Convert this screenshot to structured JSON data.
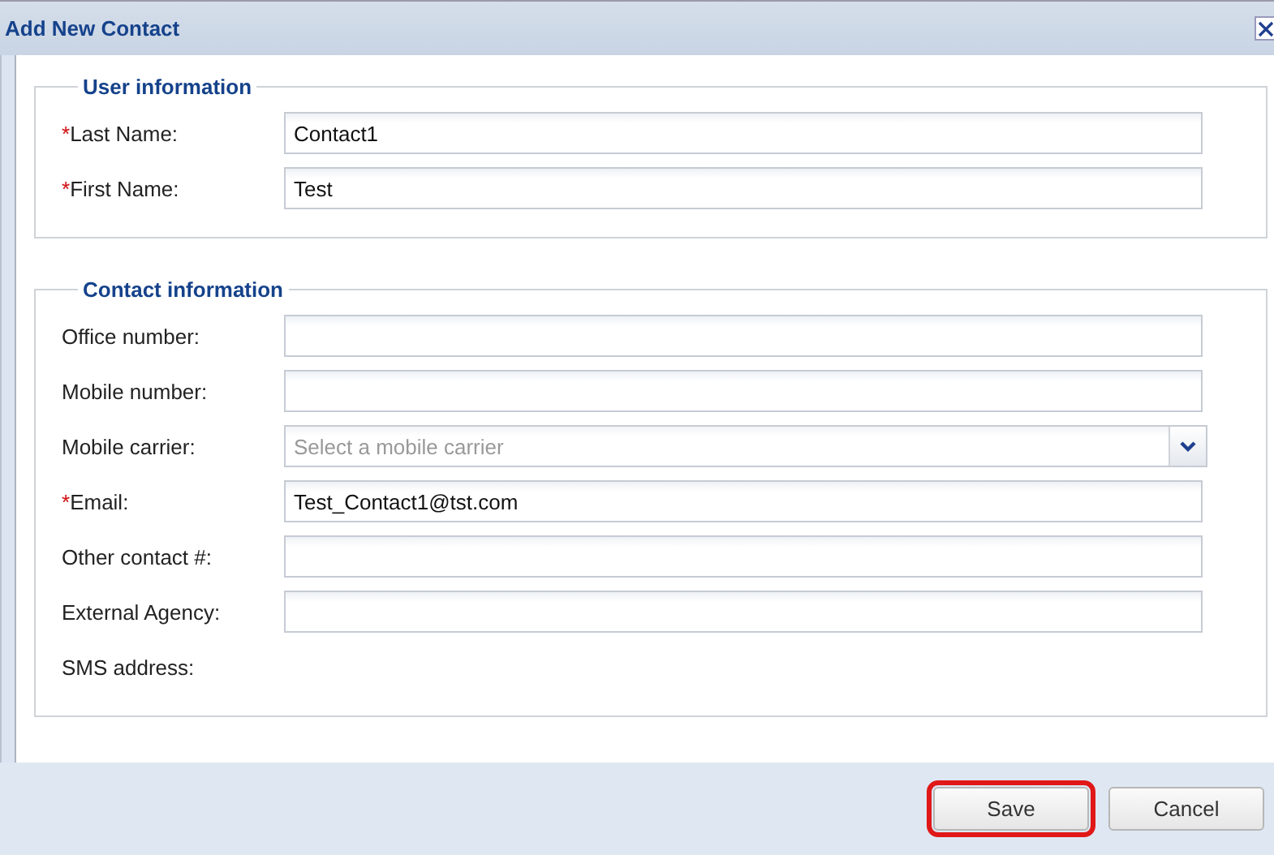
{
  "window": {
    "title": "Add New Contact"
  },
  "sections": [
    {
      "legend": "User information",
      "fields": [
        {
          "kind": "text",
          "required_mark": "*",
          "label": "Last Name:",
          "value": "Contact1"
        },
        {
          "kind": "text",
          "required_mark": "*",
          "label": "First Name:",
          "value": "Test"
        }
      ]
    },
    {
      "legend": "Contact information",
      "fields": [
        {
          "kind": "text",
          "label": "Office number:"
        },
        {
          "kind": "text",
          "label": "Mobile number:"
        },
        {
          "kind": "select",
          "label": "Mobile carrier:",
          "placeholder": "Select a mobile carrier"
        },
        {
          "kind": "text",
          "required_mark": "*",
          "label": "Email:",
          "value": "Test_Contact1@tst.com"
        },
        {
          "kind": "text",
          "label": "Other contact #:"
        },
        {
          "kind": "text",
          "label": "External Agency:"
        },
        {
          "kind": "static",
          "label": "SMS address:"
        }
      ]
    }
  ],
  "buttons": [
    {
      "label": "Save",
      "highlighted": true
    },
    {
      "label": "Cancel",
      "highlighted": false
    }
  ]
}
